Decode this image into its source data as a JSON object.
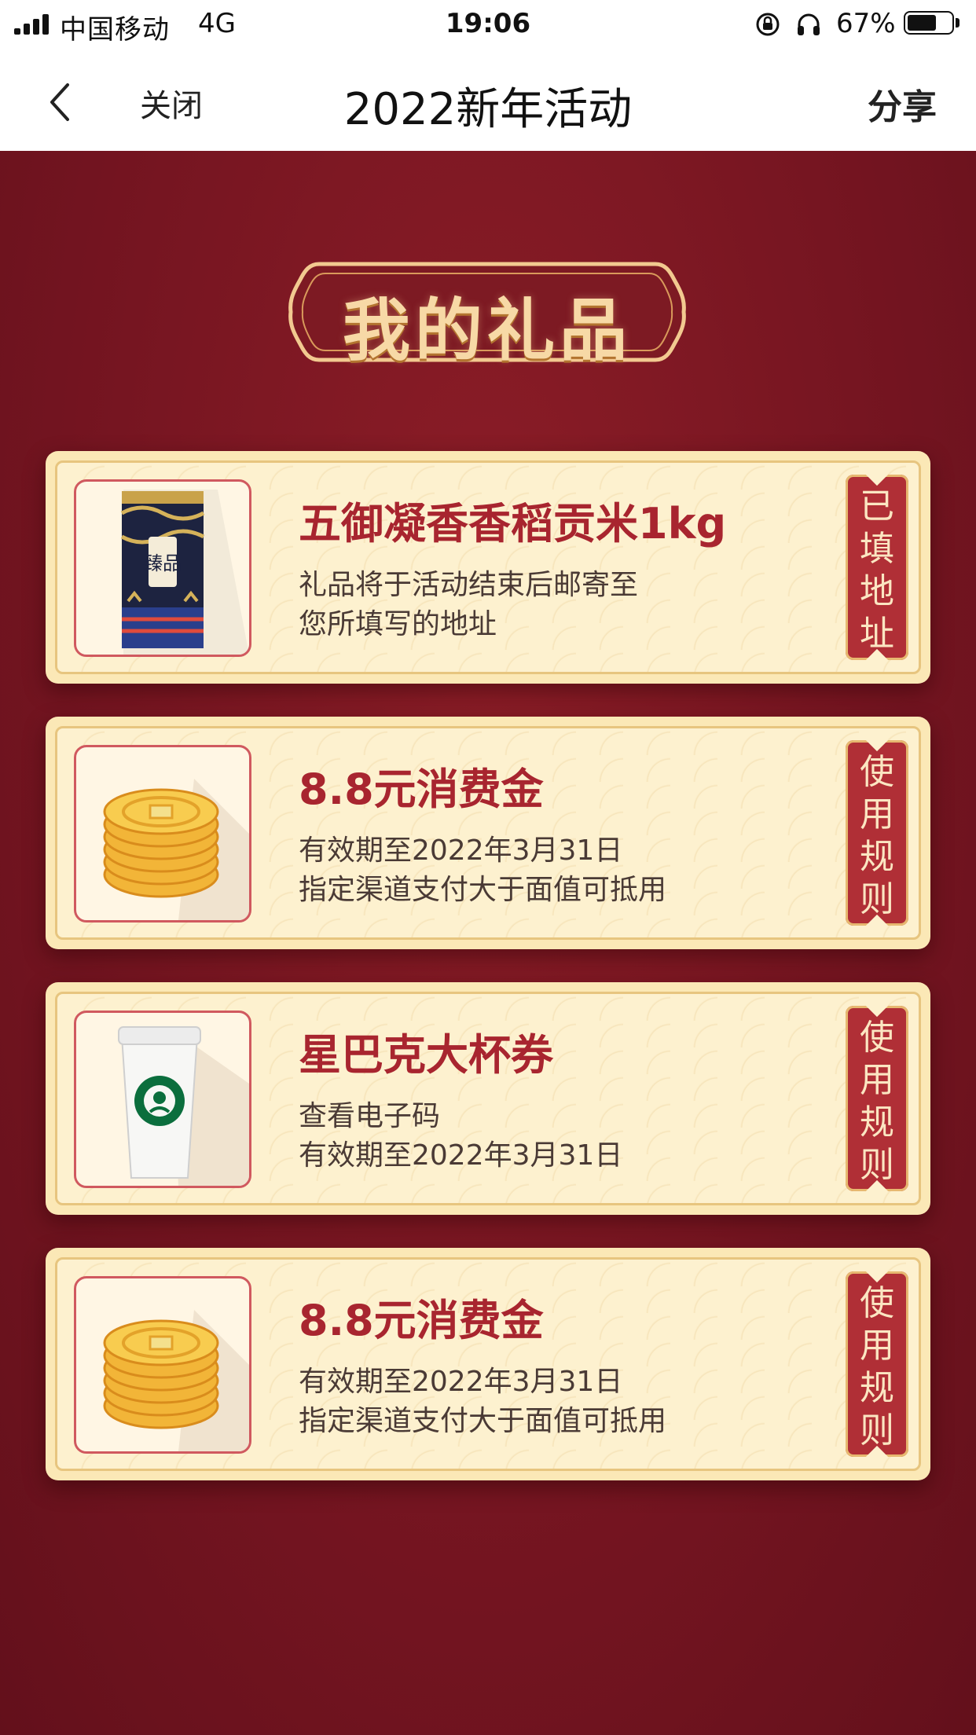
{
  "status_bar": {
    "carrier": "中国移动",
    "network": "4G",
    "time": "19:06",
    "battery_percent": "67%",
    "battery_level": 0.67
  },
  "nav": {
    "close_label": "关闭",
    "title": "2022新年活动",
    "share_label": "分享"
  },
  "banner": {
    "title": "我的礼品"
  },
  "gifts": [
    {
      "name": "五御凝香香稻贡米1kg",
      "desc_line1": "礼品将于活动结束后邮寄至",
      "desc_line2": "您所填写的地址",
      "action": [
        "已",
        "填",
        "地",
        "址"
      ],
      "image_icon": "rice-bag-icon"
    },
    {
      "name": "8.8元消费金",
      "desc_line1": "有效期至2022年3月31日",
      "desc_line2": "指定渠道支付大于面值可抵用",
      "action": [
        "使",
        "用",
        "规",
        "则"
      ],
      "image_icon": "gold-coins-icon"
    },
    {
      "name": "星巴克大杯券",
      "desc_line1": "查看电子码",
      "desc_line2": "有效期至2022年3月31日",
      "action": [
        "使",
        "用",
        "规",
        "则"
      ],
      "image_icon": "coffee-cup-icon"
    },
    {
      "name": "8.8元消费金",
      "desc_line1": "有效期至2022年3月31日",
      "desc_line2": "指定渠道支付大于面值可抵用",
      "action": [
        "使",
        "用",
        "规",
        "则"
      ],
      "image_icon": "gold-coins-icon"
    }
  ],
  "colors": {
    "page_bg": "#7a1520",
    "card_bg": "#fdf1cf",
    "title_red": "#a8252f",
    "tag_red": "#b02f36",
    "gold": "#f7d9a6"
  }
}
